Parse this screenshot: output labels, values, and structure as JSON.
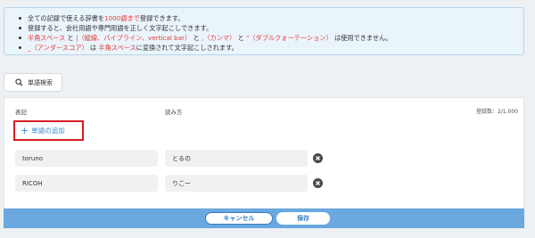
{
  "info": {
    "line1": [
      "全ての記録で使える辞書を",
      "1000語まで",
      "登録できます。"
    ],
    "line2": "登録すると、会社用語や専門用語を正しく文字起こしできます。",
    "line3": [
      "半角スペース",
      " と ",
      "|（縦線、パイプライン、vertical bar）",
      " と ",
      ",（カンマ）",
      " と ",
      "\"（ダブルクォーテーション）",
      " は使用できません。"
    ],
    "line4": [
      "_（アンダースコア）",
      " は ",
      "半角スペース",
      "に変換されて文字起こしされます。"
    ]
  },
  "search_tab": {
    "label": "単語検索",
    "icon": "search-icon"
  },
  "table": {
    "col_notation": "表記",
    "col_reading": "読み方",
    "count_label": "登録数：2/1,000",
    "add_label": "単語の追加",
    "rows": [
      {
        "notation": "toruno",
        "reading": "とるの"
      },
      {
        "notation": "RICOH",
        "reading": "りこー"
      }
    ]
  },
  "footer": {
    "cancel_label": "キャンセル",
    "save_label": "保存"
  },
  "colors": {
    "accent": "#3b8bd0",
    "warning": "#e23b3b",
    "footer": "#6aa8df",
    "highlight_border": "#d71c24"
  }
}
